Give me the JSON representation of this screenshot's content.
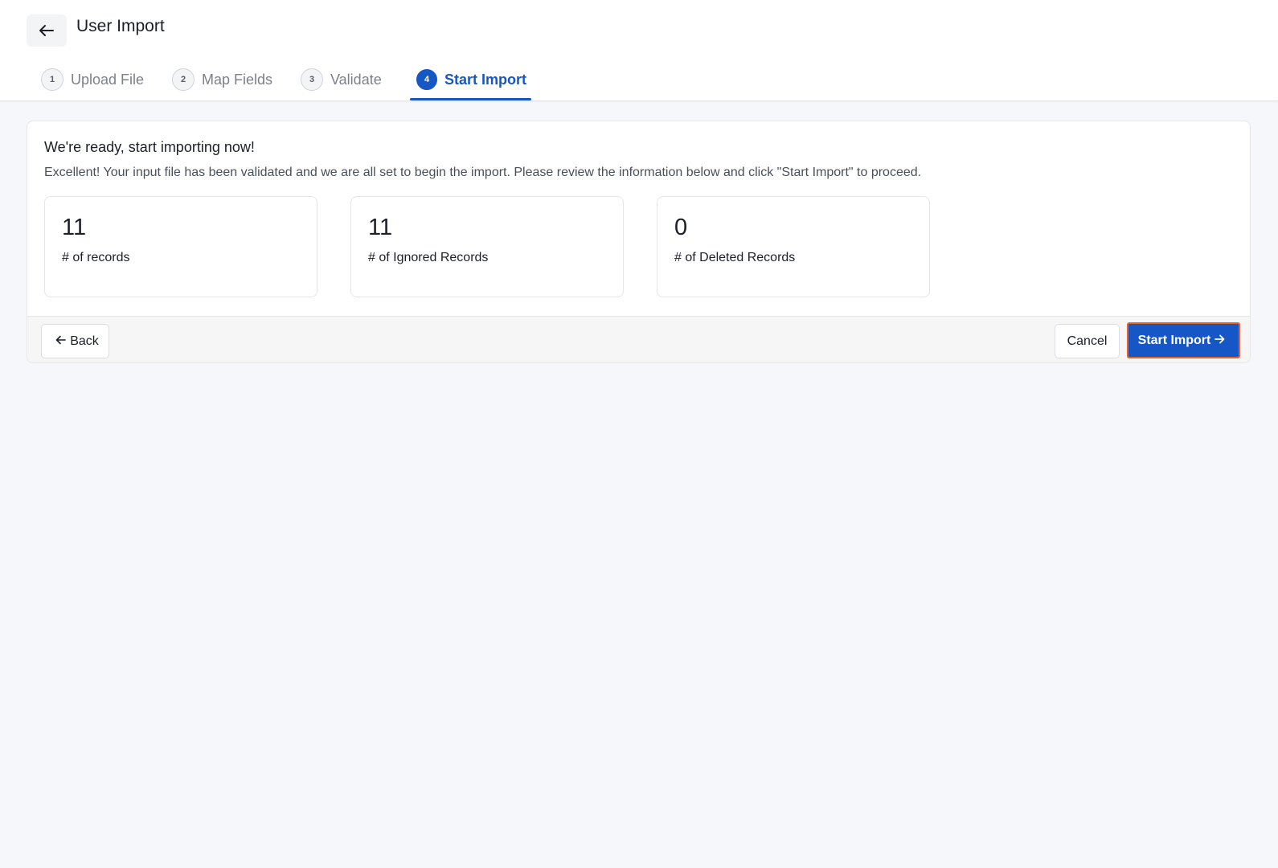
{
  "header": {
    "title": "User Import",
    "back_icon": "arrow-left-icon"
  },
  "steps": [
    {
      "num": "1",
      "label": "Upload File",
      "active": false
    },
    {
      "num": "2",
      "label": "Map Fields",
      "active": false
    },
    {
      "num": "3",
      "label": "Validate",
      "active": false
    },
    {
      "num": "4",
      "label": "Start Import",
      "active": true
    }
  ],
  "summary": {
    "title": "We're ready, start importing now!",
    "description": "Excellent! Your input file has been validated and we are all set to begin the import. Please review the information below and click \"Start Import\" to proceed."
  },
  "stats": [
    {
      "value": "11",
      "label": "# of records"
    },
    {
      "value": "11",
      "label": "# of Ignored Records"
    },
    {
      "value": "0",
      "label": "# of Deleted Records"
    }
  ],
  "footer": {
    "back_label": "Back",
    "cancel_label": "Cancel",
    "start_label": "Start Import"
  },
  "colors": {
    "accent": "#1656c5",
    "focus_outline": "#e8622a",
    "background": "#f6f7fa"
  }
}
